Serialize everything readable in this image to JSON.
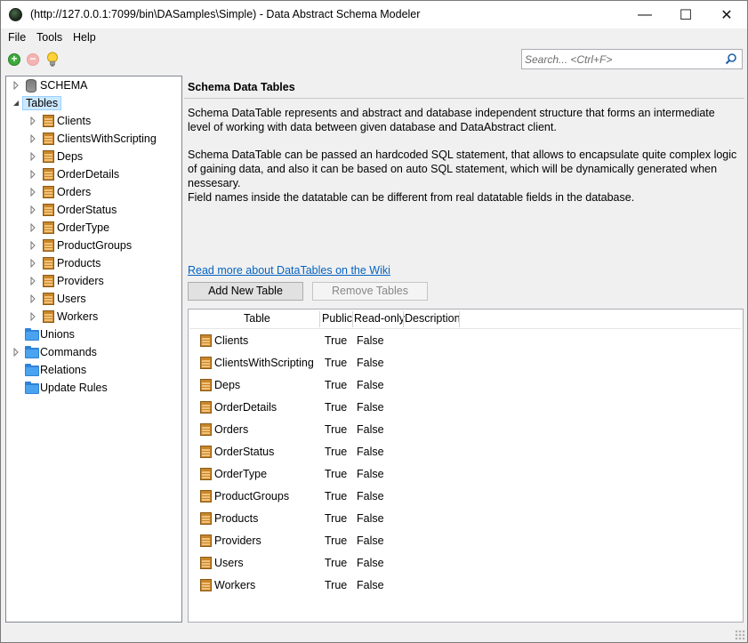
{
  "window": {
    "title": "(http://127.0.0.1:7099/bin\\DASamples\\Simple) - Data Abstract Schema Modeler",
    "controls": {
      "minimize": "—",
      "maximize": "☐",
      "close": "✕"
    }
  },
  "menu": {
    "file": "File",
    "tools": "Tools",
    "help": "Help"
  },
  "toolbar": {
    "icons": [
      "add-icon",
      "remove-icon",
      "lightbulb-icon"
    ],
    "search": {
      "placeholder": "Search... <Ctrl+F>",
      "value": ""
    }
  },
  "tree": {
    "schema": "SCHEMA",
    "tables_label": "Tables",
    "tables": [
      "Clients",
      "ClientsWithScripting",
      "Deps",
      "OrderDetails",
      "Orders",
      "OrderStatus",
      "OrderType",
      "ProductGroups",
      "Products",
      "Providers",
      "Users",
      "Workers"
    ],
    "unions": "Unions",
    "commands": "Commands",
    "relations": "Relations",
    "update_rules": "Update Rules"
  },
  "main": {
    "heading": "Schema Data Tables",
    "paragraph1": "Schema DataTable represents and abstract and database independent structure that forms an intermediate level of working with data between given database and DataAbstract client.",
    "paragraph2": "Schema DataTable can be passed an hardcoded SQL statement, that allows to encapsulate  quite complex logic of gaining data, and also it can be based on auto SQL statement, which will be dynamically generated when nessesary.",
    "paragraph3": "Field names inside the datatable can be different from real datatable fields in the database.",
    "wiki_link": "Read more about DataTables on the Wiki",
    "add_button": "Add New Table",
    "remove_button": "Remove Tables"
  },
  "grid": {
    "columns": [
      "Table",
      "Public",
      "Read-only",
      "Description"
    ],
    "rows": [
      {
        "table": "Clients",
        "public": "True",
        "readonly": "False",
        "description": ""
      },
      {
        "table": "ClientsWithScripting",
        "public": "True",
        "readonly": "False",
        "description": ""
      },
      {
        "table": "Deps",
        "public": "True",
        "readonly": "False",
        "description": ""
      },
      {
        "table": "OrderDetails",
        "public": "True",
        "readonly": "False",
        "description": ""
      },
      {
        "table": "Orders",
        "public": "True",
        "readonly": "False",
        "description": ""
      },
      {
        "table": "OrderStatus",
        "public": "True",
        "readonly": "False",
        "description": ""
      },
      {
        "table": "OrderType",
        "public": "True",
        "readonly": "False",
        "description": ""
      },
      {
        "table": "ProductGroups",
        "public": "True",
        "readonly": "False",
        "description": ""
      },
      {
        "table": "Products",
        "public": "True",
        "readonly": "False",
        "description": ""
      },
      {
        "table": "Providers",
        "public": "True",
        "readonly": "False",
        "description": ""
      },
      {
        "table": "Users",
        "public": "True",
        "readonly": "False",
        "description": ""
      },
      {
        "table": "Workers",
        "public": "True",
        "readonly": "False",
        "description": ""
      }
    ]
  }
}
